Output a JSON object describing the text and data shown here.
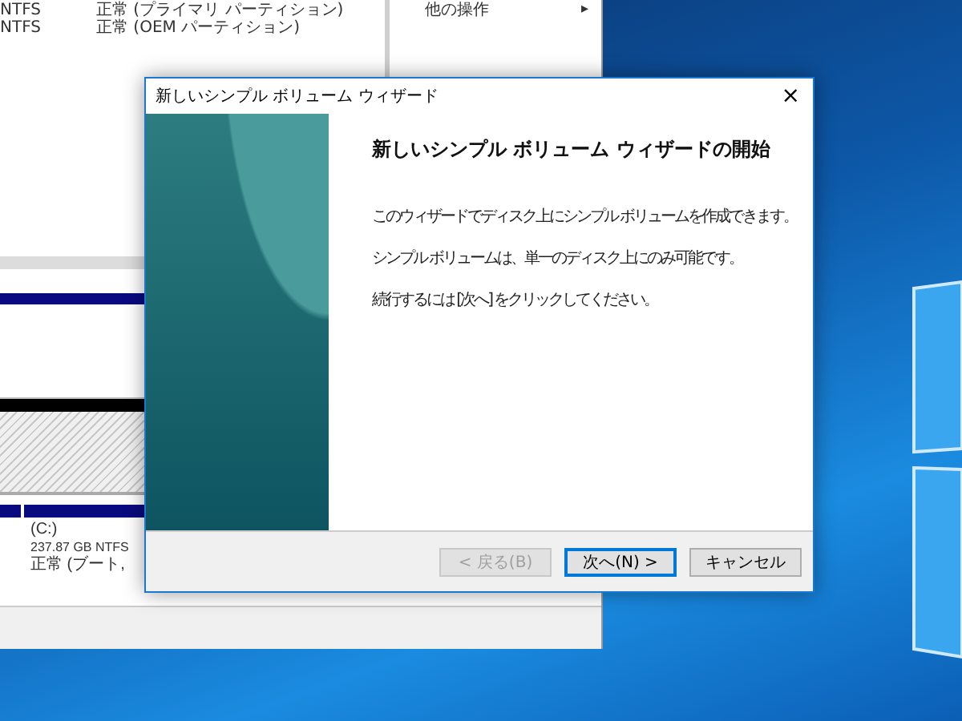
{
  "disk_management": {
    "volume_rows": [
      {
        "file_system": "NTFS",
        "status": "正常 (プライマリ パーティション)"
      },
      {
        "file_system": "NTFS",
        "status": "正常 (OEM パーティション)"
      }
    ],
    "actions_pane": {
      "item": "他の操作",
      "arrow": "▸"
    },
    "partition": {
      "name": "(C:)",
      "size": "237.87 GB NTFS",
      "status": "正常 (ブート,"
    }
  },
  "wizard": {
    "title": "新しいシンプル ボリューム ウィザード",
    "close": "×",
    "heading": "新しいシンプル ボリューム ウィザードの開始",
    "paragraphs": [
      "このウィザードでディスク上にシンプル ボリュームを作成できます。",
      "シンプル ボリュームは、単一のディスク上にのみ可能です。",
      "続行するには [次へ] をクリックしてください。"
    ],
    "buttons": [
      {
        "label": "< 戻る(B)",
        "disabled": true,
        "selected": false
      },
      {
        "label": "次へ(N) >",
        "disabled": false,
        "selected": true
      },
      {
        "label": "キャンセル",
        "disabled": false,
        "selected": false
      }
    ]
  }
}
